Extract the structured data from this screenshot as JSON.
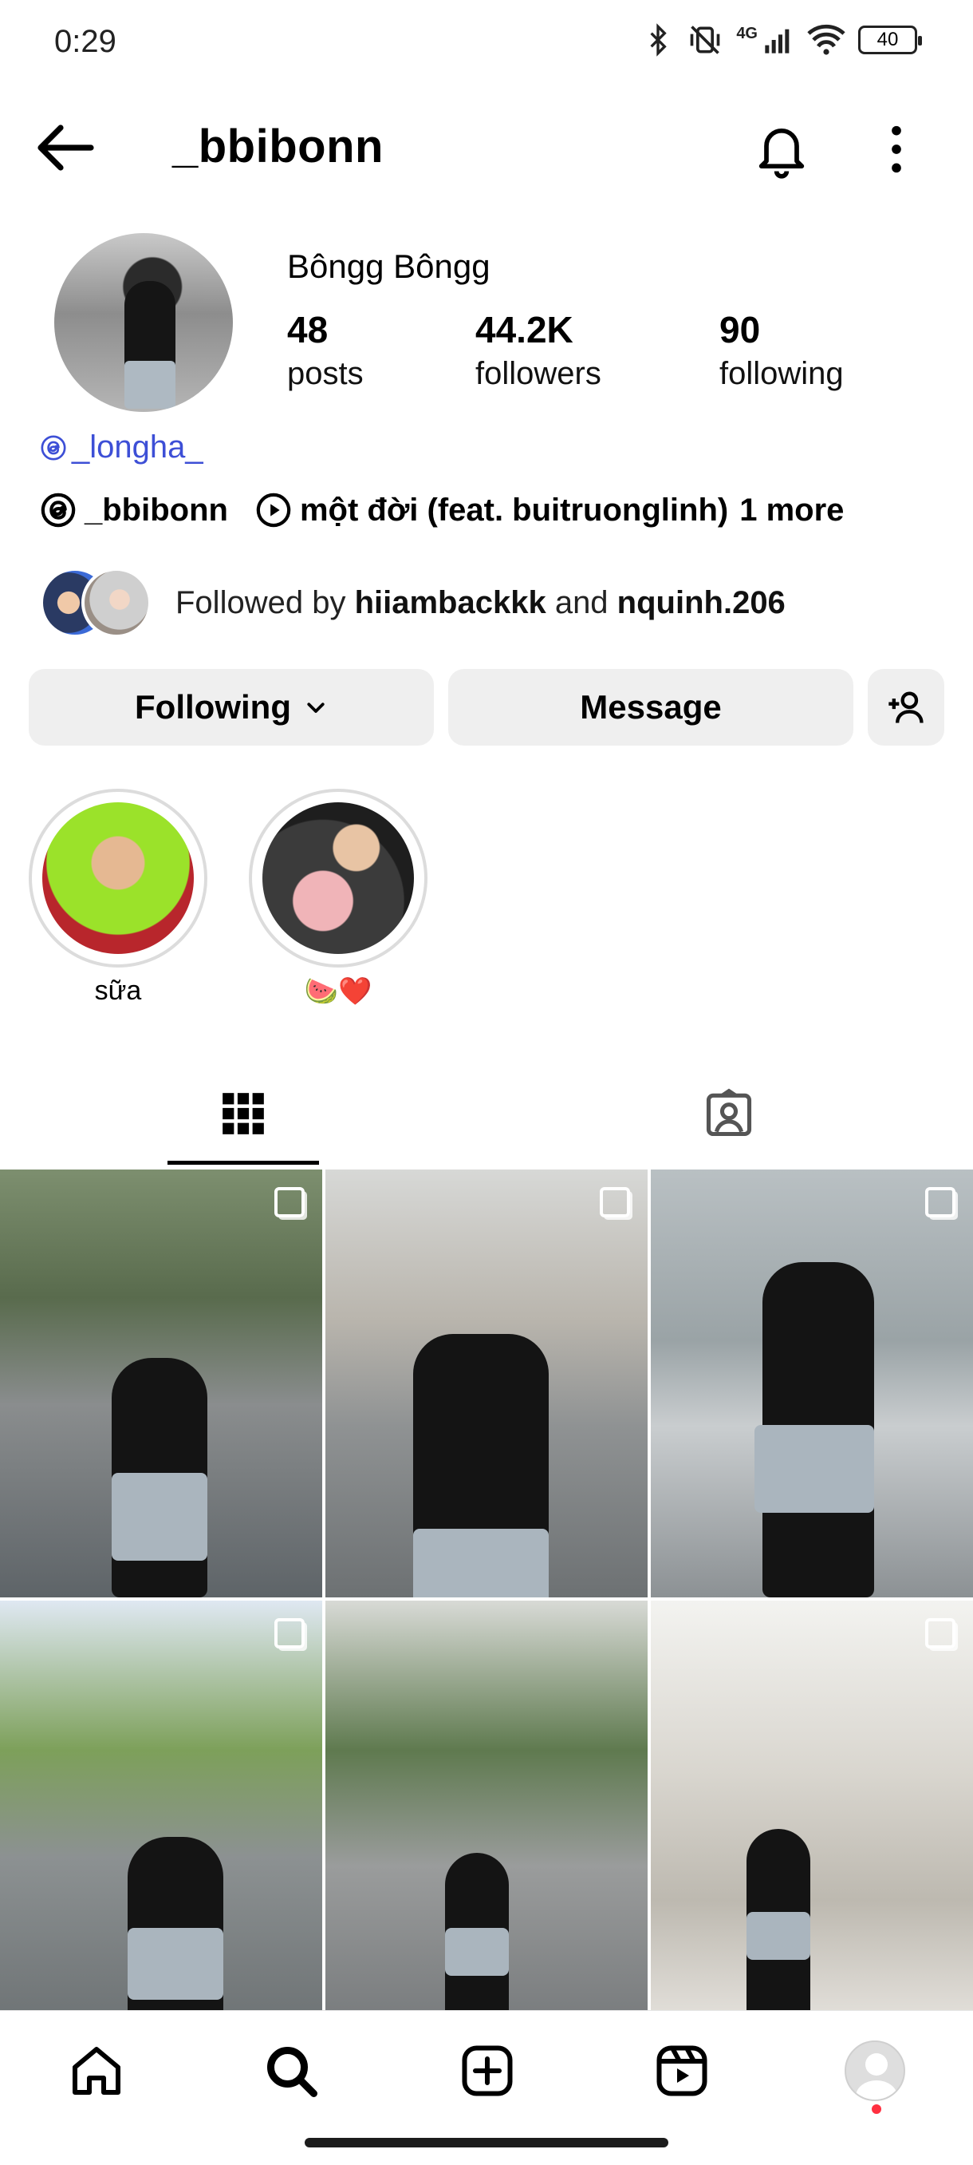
{
  "status_bar": {
    "time": "0:29",
    "network": "4G",
    "battery": "40"
  },
  "header": {
    "username": "_bbibonn",
    "icons": [
      "back-arrow-icon",
      "bell-icon",
      "more-vert-icon"
    ]
  },
  "profile": {
    "display_name": "Bôngg Bôngg",
    "stats": [
      {
        "value": "48",
        "label": "posts"
      },
      {
        "value": "44.2K",
        "label": "followers"
      },
      {
        "value": "90",
        "label": "following"
      }
    ],
    "threads_mention": "_longha_",
    "threads_handle": "_bbibonn",
    "music": "một đời (feat. buitruonglinh)",
    "more_link": "1 more",
    "followed_by_prefix": "Followed by ",
    "followed_by_user1": "hiiambackkk",
    "followed_by_and": " and ",
    "followed_by_user2": "nquinh.206"
  },
  "actions": {
    "following_label": "Following",
    "message_label": "Message"
  },
  "highlights": [
    {
      "title": "sữa"
    },
    {
      "title": "🍉❤️"
    }
  ],
  "tabs": [
    "grid-icon",
    "tagged-icon"
  ],
  "nav": [
    "home-icon",
    "search-icon",
    "create-icon",
    "reels-icon",
    "profile-avatar"
  ],
  "colors": {
    "link_blue": "#3d4fd6",
    "button_bg": "#efefef",
    "notification_red": "#ff3040"
  }
}
